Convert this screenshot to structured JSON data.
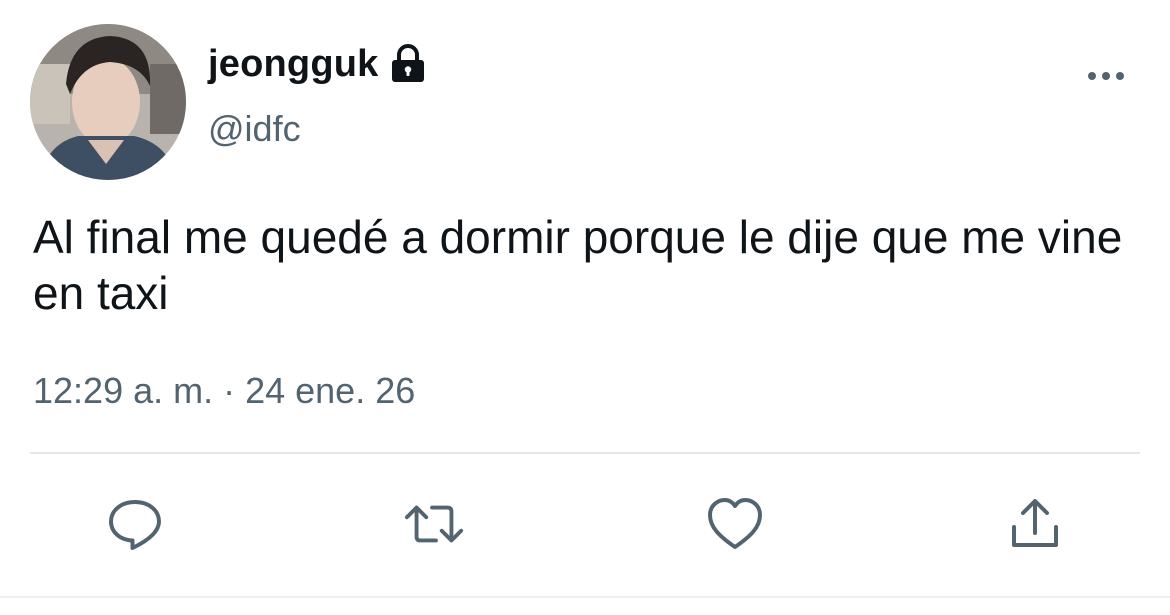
{
  "tweet": {
    "author": {
      "display_name": "jeongguk",
      "handle": "@idfc",
      "protected_icon": "lock-icon",
      "avatar": "profile-photo"
    },
    "text": "Al final me quedé a dormir porque le dije que me vine en taxi",
    "meta": "12:29 a. m. · 24 ene. 26",
    "menu_icon": "more-horizontal-icon",
    "actions": [
      {
        "name": "reply",
        "icon": "reply-icon"
      },
      {
        "name": "retweet",
        "icon": "retweet-icon"
      },
      {
        "name": "like",
        "icon": "heart-icon"
      },
      {
        "name": "share",
        "icon": "share-icon"
      }
    ]
  },
  "colors": {
    "text_primary": "#0f1419",
    "text_secondary": "#536471",
    "icon": "#536471",
    "divider": "#e1e6ea"
  }
}
